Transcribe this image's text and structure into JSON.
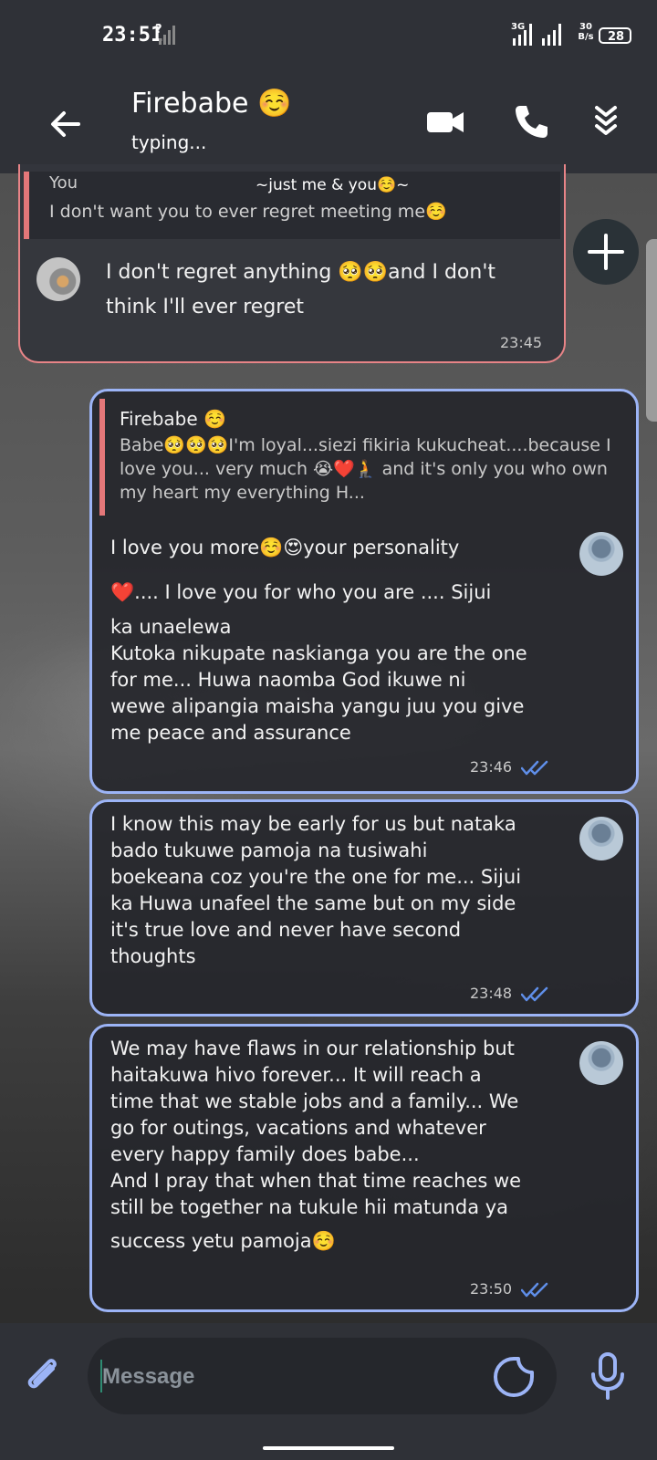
{
  "status": {
    "time": "23:51",
    "net_type": "3G",
    "speed_value": "30",
    "speed_unit": "B/s",
    "battery": "28"
  },
  "header": {
    "title": "Firebabe ☺️",
    "subtitle": "typing..."
  },
  "pinned_reply": {
    "sender": "You",
    "banner": "~just me & you☺️~",
    "text": "I don't want you to ever regret meeting me☺️"
  },
  "messages": [
    {
      "direction": "in",
      "line1": "I don't regret anything 🥺🥺and I don't",
      "line2": "think I'll ever regret",
      "time": "23:45"
    },
    {
      "direction": "out",
      "reply_sender": "Firebabe ☺️",
      "reply_text": "Babe🥺🥺🥺I'm loyal...siezi fikiria kukucheat....because I love you... very much 😭❤️🧎 and it's only you who own my heart my everything H...",
      "lines": [
        "I love you more☺️😍your personality",
        "❤️.... I love you for who you are .... Sijui",
        "ka unaelewa",
        "Kutoka nikupate naskianga you are the one",
        "for me... Huwa naomba God ikuwe ni",
        "wewe alipangia maisha yangu juu you give",
        "me peace and assurance"
      ],
      "time": "23:46"
    },
    {
      "direction": "out",
      "lines": [
        "I know this may be early for us but nataka",
        "bado tukuwe pamoja na tusiwahi",
        "boekeana coz you're the one for me... Sijui",
        "ka Huwa unafeel the same but on my side",
        "it's true love and never have second",
        "thoughts"
      ],
      "time": "23:48"
    },
    {
      "direction": "out",
      "lines": [
        "We may have flaws in our relationship but",
        "haitakuwa hivo forever... It will reach a",
        "time that we stable jobs and a family... We",
        "go for outings, vacations and whatever",
        "every happy family does babe...",
        "And I pray that when that time reaches we",
        "still be together na tukule hii matunda ya",
        "success yetu pamoja☺️"
      ],
      "time": "23:50"
    }
  ],
  "composer": {
    "placeholder": "Message"
  },
  "icons": {
    "back": "arrow-left-icon",
    "video": "video-camera-icon",
    "call": "phone-icon",
    "more": "double-chevron-down-icon",
    "fab": "plus-icon",
    "attach": "paperclip-icon",
    "sticker": "sticker-icon",
    "mic": "microphone-icon",
    "read": "double-check-icon"
  },
  "colors": {
    "header_bg": "#2f3137",
    "incoming_border": "#e88487",
    "outgoing_border": "#9cb4f6",
    "tick": "#5f8ee8",
    "reply_bar": "#e47779"
  }
}
